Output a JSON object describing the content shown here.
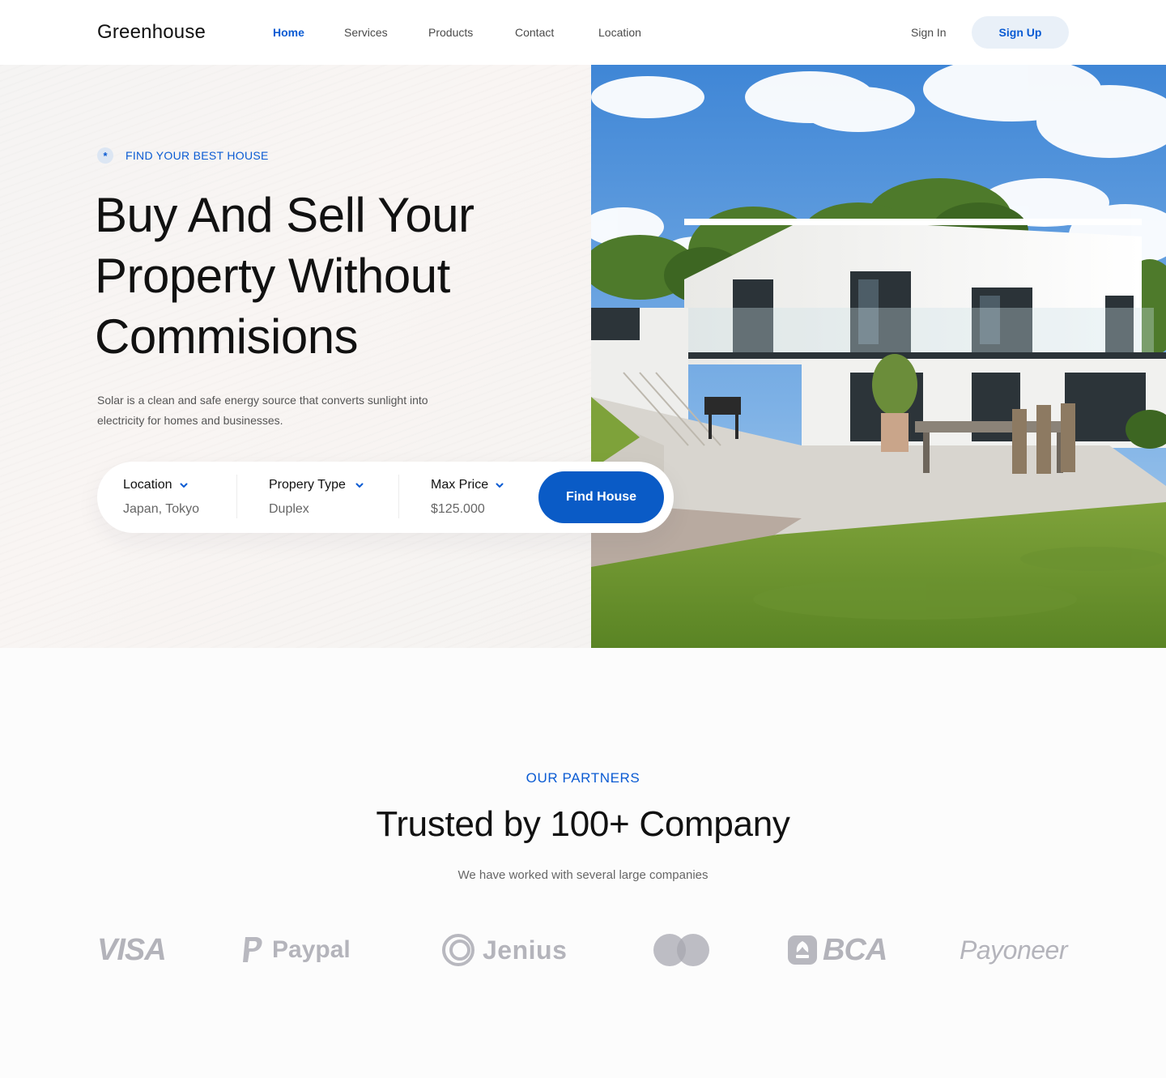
{
  "nav": {
    "brand": "Greenhouse",
    "links": [
      "Home",
      "Services",
      "Products",
      "Contact",
      "Location"
    ],
    "active": "Home",
    "sign_in": "Sign In",
    "sign_up": "Sign Up"
  },
  "hero": {
    "eyebrow_icon": "*",
    "eyebrow": "FIND YOUR BEST HOUSE",
    "title_lines": [
      "Buy And Sell Your",
      "Property Without",
      "Commisions"
    ],
    "description_lines": [
      "Solar is a clean and safe energy source that converts sunlight into",
      "electricity for homes and businesses."
    ],
    "image": "modern-white-house-photo"
  },
  "search": {
    "fields": [
      {
        "label": "Location",
        "value": "Japan, Tokyo"
      },
      {
        "label": "Propery Type",
        "value": "Duplex"
      },
      {
        "label": "Max Price",
        "value": "$125.000"
      }
    ],
    "button": "Find House"
  },
  "partners": {
    "eyebrow": "OUR PARTNERS",
    "title": "Trusted by 100+ Company",
    "subtitle": "We have worked with several large companies",
    "logos": [
      {
        "name": "visa-logo",
        "text": "VISA"
      },
      {
        "name": "paypal-logo",
        "text": "Paypal"
      },
      {
        "name": "jenius-logo",
        "text": "Jenius"
      },
      {
        "name": "mastercard-logo",
        "text": ""
      },
      {
        "name": "bca-logo",
        "text": "BCA"
      },
      {
        "name": "payoneer-logo",
        "text": "Payoneer"
      }
    ]
  },
  "colors": {
    "accent": "#0a5bd3",
    "button": "#0a5bc6",
    "signup_bg": "#e9f0f8",
    "logo_gray": "#b4b4bb"
  }
}
